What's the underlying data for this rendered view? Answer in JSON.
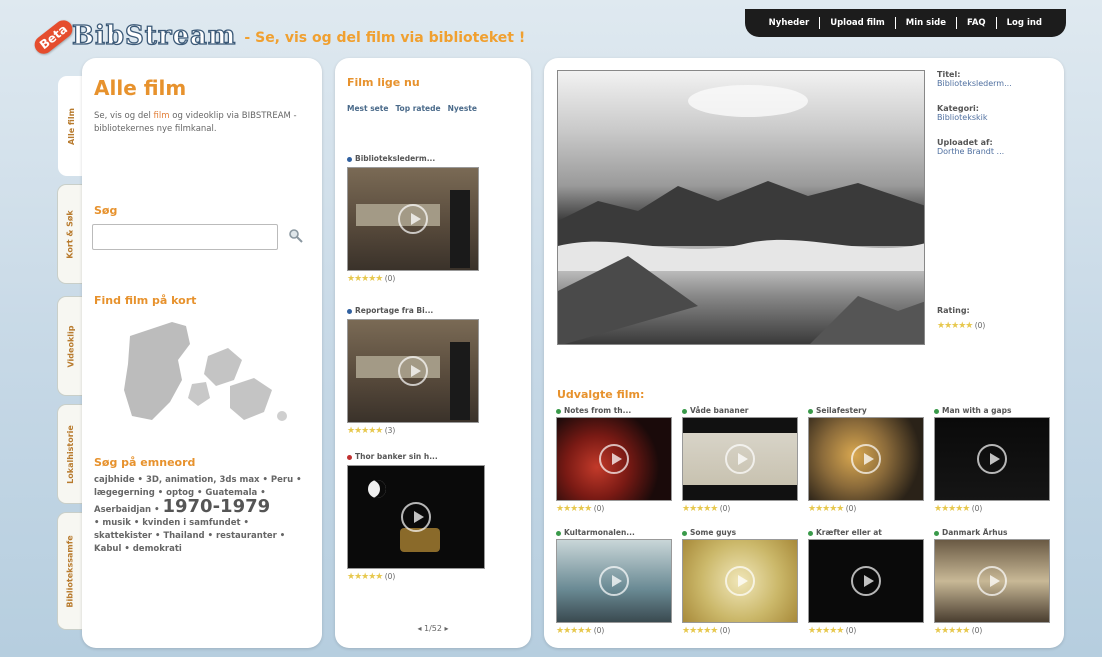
{
  "header": {
    "beta": "Beta",
    "brand": "BibStream",
    "tagline": "- Se, vis og del film via biblioteket !",
    "nav": [
      "Nyheder",
      "Upload film",
      "Min side",
      "FAQ",
      "Log ind"
    ]
  },
  "tabs": [
    "Alle film",
    "Kort & Søk",
    "Videoklip",
    "Lokalhistorie",
    "Bibliotekssamfe"
  ],
  "left": {
    "title": "Alle film",
    "intro_before": "Se, vis og del ",
    "intro_link": "film",
    "intro_after": " og videoklip via BIBSTREAM - bibliotekernes nye filmkanal.",
    "search_title": "Søg",
    "search_placeholder": "",
    "map_title": "Find film på kort",
    "tag_title": "Søg på emneord",
    "tags1": "cajbhide • 3D, animation, 3ds max • Peru • lægegerning • optog • Guatemala •",
    "tags2_pre": "Aserbaidjan •",
    "tags2_big": "1970-1979",
    "tags3": "• musik • kvinden i samfundet • skattekister • Thailand • restauranter • Kabul • demokrati"
  },
  "middle": {
    "title": "Film lige nu",
    "sort": [
      "Mest sete",
      "Top ratede",
      "Nyeste"
    ],
    "items": [
      {
        "title": "Bibliotekslederm...",
        "stars": "★★★★★",
        "count": "(0)",
        "dot": "#3060a0"
      },
      {
        "title": "Reportage fra Bi...",
        "stars": "★★★★★",
        "count": "(3)",
        "dot": "#3060a0"
      },
      {
        "title": "Thor banker sin h...",
        "stars": "★★★★★",
        "count": "(0)",
        "dot": "#c03030"
      }
    ],
    "pager": "1/52"
  },
  "right": {
    "info": [
      {
        "label": "Titel:",
        "value": "Bibliotekslederm..."
      },
      {
        "label": "Kategori:",
        "value": "Bibliotekskik"
      },
      {
        "label": "Uploadet af:",
        "value": "Dorthe Brandt ..."
      }
    ],
    "rating_label": "Rating:",
    "rating_stars": "★★★★★",
    "rating_count": "(0)",
    "featured_title": "Udvalgte film:",
    "thumbs": [
      {
        "title": "Notes from th...",
        "count": "(0)",
        "dot": "#3a9a4a"
      },
      {
        "title": "Våde bananer",
        "count": "(0)",
        "dot": "#3a9a4a"
      },
      {
        "title": "Seilafestery",
        "count": "(0)",
        "dot": "#3a9a4a"
      },
      {
        "title": "Man with a gaps",
        "count": "(0)",
        "dot": "#3a9a4a"
      },
      {
        "title": "Kultarmonalen...",
        "count": "(0)",
        "dot": "#3a9a4a"
      },
      {
        "title": "Some guys",
        "count": "(0)",
        "dot": "#3a9a4a"
      },
      {
        "title": "Kræfter eller at",
        "count": "(0)",
        "dot": "#3a9a4a"
      },
      {
        "title": "Danmark Århus",
        "count": "(0)",
        "dot": "#3a9a4a"
      }
    ],
    "thumb_stars": "★★★★★"
  }
}
